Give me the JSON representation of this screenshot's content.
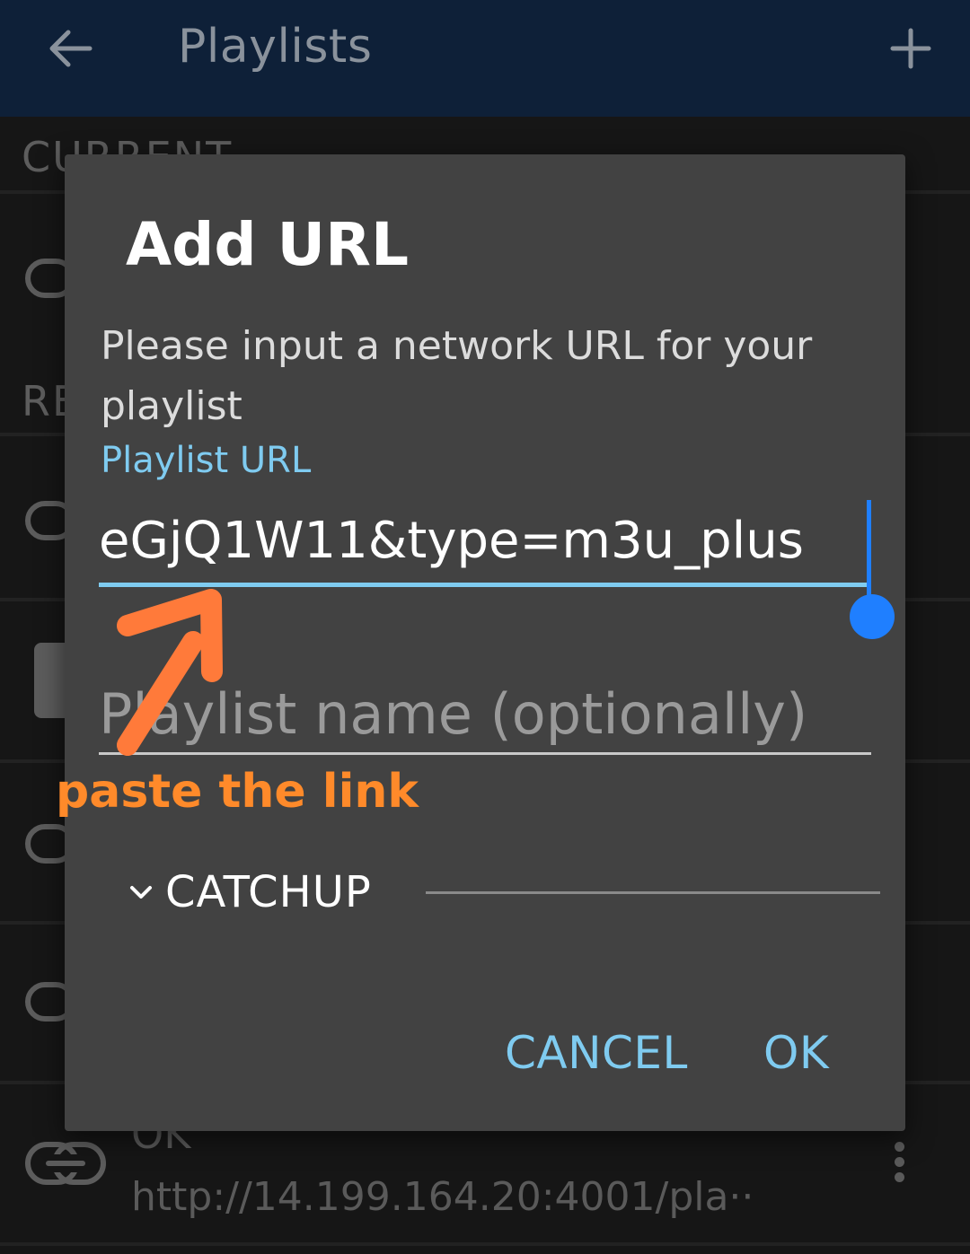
{
  "appbar": {
    "title": "Playlists",
    "back_icon": "arrow-left-icon",
    "add_icon": "plus-icon",
    "background": "#0e2038"
  },
  "list": {
    "sections": [
      "CURRENT",
      "RE"
    ],
    "partial_item": {
      "title": "OK",
      "url": "http://14.199.164.20:4001/pla··"
    },
    "row_icon": "link-icon",
    "menu_icon": "more-vertical-icon"
  },
  "dialog": {
    "title": "Add URL",
    "message": "Please input a network URL for your playlist",
    "url_label": "Playlist URL",
    "url_value": "eGjQ1W11&type=m3u_plus",
    "name_placeholder": "Playlist name (optionally)",
    "catchup_label": "CATCHUP",
    "catchup_icon": "chevron-down-icon",
    "cancel_label": "CANCEL",
    "ok_label": "OK",
    "accent": "#7fcbf0",
    "background": "#424242"
  },
  "annotation": {
    "text": "paste the link",
    "color": "#ff8a2a"
  }
}
